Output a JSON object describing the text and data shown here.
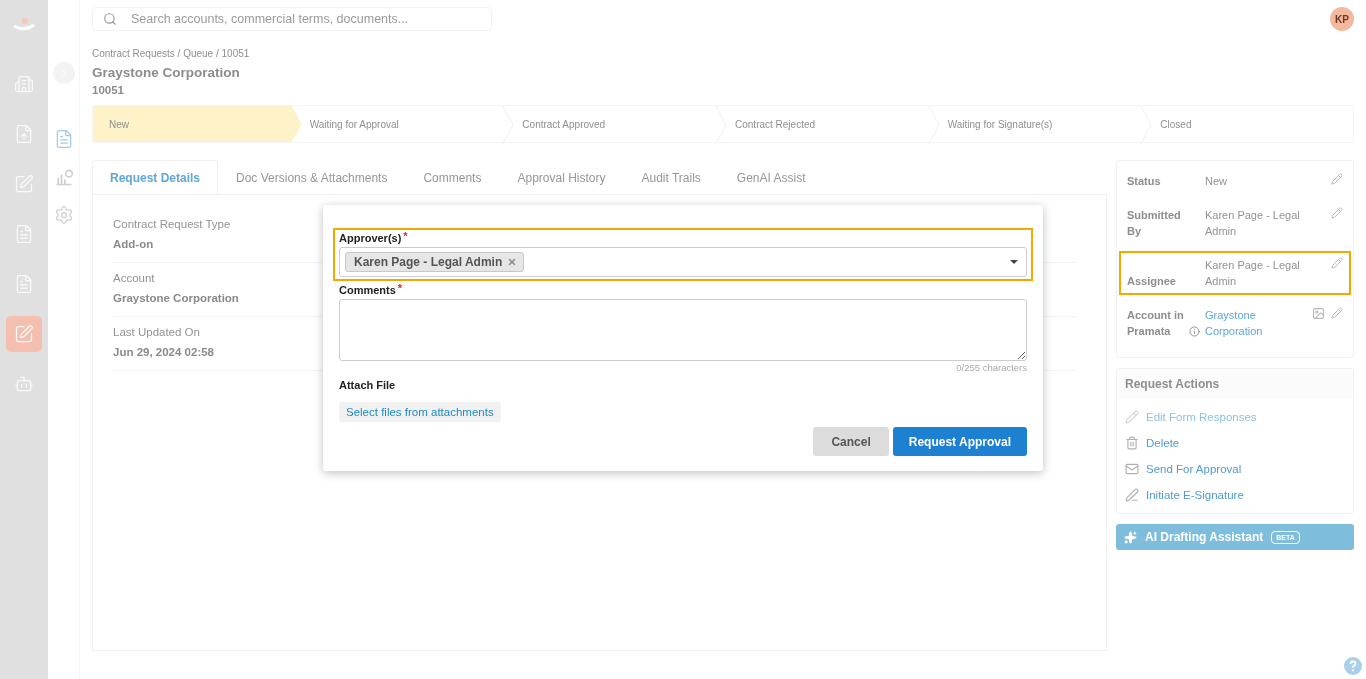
{
  "rail": {
    "items": [
      {
        "selected": false
      },
      {
        "selected": false
      },
      {
        "selected": false
      },
      {
        "selected": false
      },
      {
        "selected": false
      },
      {
        "selected": true
      },
      {
        "selected": false
      }
    ]
  },
  "subrail": {
    "items": [
      {
        "selected": true
      },
      {
        "selected": false
      },
      {
        "selected": false
      }
    ]
  },
  "search": {
    "placeholder": "Search accounts, commercial terms, documents..."
  },
  "user": {
    "initials": "KP"
  },
  "breadcrumb": "Contract Requests / Queue / 10051",
  "title": "Graystone Corporation",
  "request_id": "10051",
  "steps": [
    {
      "label": "New",
      "selected": true
    },
    {
      "label": "Waiting for Approval",
      "selected": false
    },
    {
      "label": "Contract Approved",
      "selected": false
    },
    {
      "label": "Contract Rejected",
      "selected": false
    },
    {
      "label": "Waiting for Signature(s)",
      "selected": false
    },
    {
      "label": "Closed",
      "selected": false
    }
  ],
  "tabs": [
    {
      "label": "Request Details",
      "selected": true
    },
    {
      "label": "Doc Versions & Attachments",
      "selected": false
    },
    {
      "label": "Comments",
      "selected": false
    },
    {
      "label": "Approval History",
      "selected": false
    },
    {
      "label": "Audit Trails",
      "selected": false
    },
    {
      "label": "GenAI Assist",
      "selected": false
    }
  ],
  "details": [
    {
      "label": "Contract Request Type",
      "value": "Add-on"
    },
    {
      "label": "Account",
      "value": "Graystone Corporation"
    },
    {
      "label": "Last Updated On",
      "value": "Jun 29, 2024 02:58"
    }
  ],
  "side_fields": [
    {
      "label": "Status",
      "value": "New",
      "kind": "text",
      "highlighted": false
    },
    {
      "label": "Submitted By",
      "value": "Karen Page - Legal Admin",
      "kind": "text",
      "highlighted": false
    },
    {
      "label": "Assignee",
      "value": "Karen Page - Legal Admin",
      "kind": "text",
      "highlighted": true
    },
    {
      "label": "Account in Pramata",
      "value": "Graystone Corporation",
      "kind": "link",
      "highlighted": false
    }
  ],
  "request_actions": {
    "title": "Request Actions",
    "items": [
      {
        "label": "Edit Form Responses",
        "disabled": true
      },
      {
        "label": "Delete",
        "disabled": false
      },
      {
        "label": "Send For Approval",
        "disabled": false
      },
      {
        "label": "Initiate E-Signature",
        "disabled": false
      }
    ]
  },
  "ai_button": {
    "label": "AI Drafting Assistant",
    "badge": "BETA"
  },
  "modal": {
    "approver": {
      "label": "Approver(s)",
      "required_mark": "*",
      "highlighted": true,
      "tags": [
        "Karen Page - Legal Admin"
      ]
    },
    "comments": {
      "label": "Comments",
      "required_mark": "*",
      "counter": "0/255 characters"
    },
    "attach": {
      "label": "Attach File",
      "button": "Select files from attachments"
    },
    "buttons": [
      {
        "label": "Cancel",
        "kind": "secondary"
      },
      {
        "label": "Request Approval",
        "kind": "primary"
      }
    ]
  }
}
